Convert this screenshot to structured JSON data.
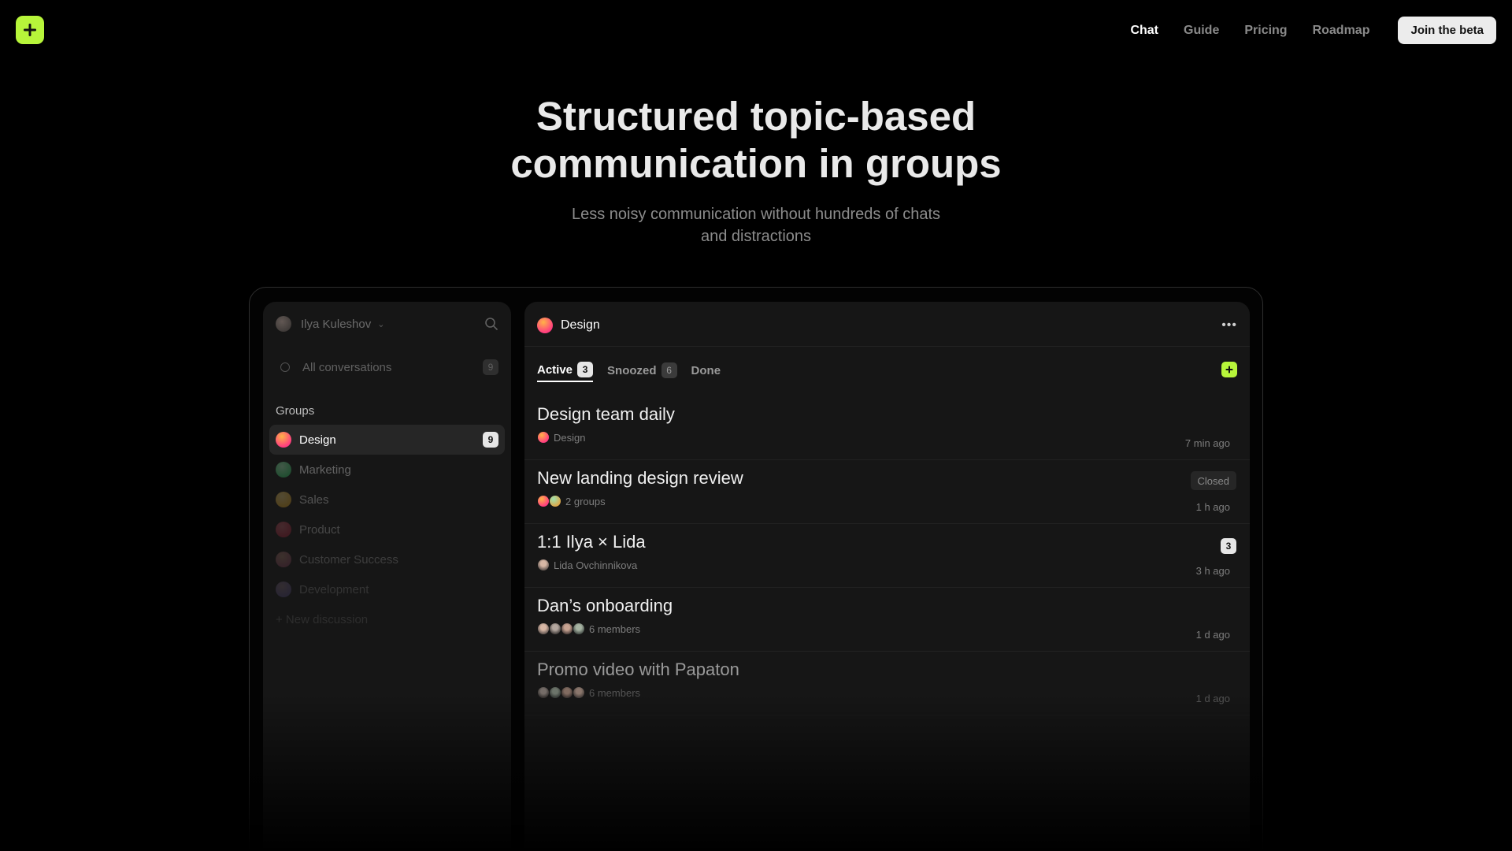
{
  "nav": {
    "links": [
      "Chat",
      "Guide",
      "Pricing",
      "Roadmap"
    ],
    "active": "Chat",
    "cta": "Join the beta"
  },
  "hero": {
    "title": "Structured topic-based\ncommunication in groups",
    "subtitle": "Less noisy communication without hundreds of chats\nand distractions"
  },
  "sidebar": {
    "user_name": "Ilya Kuleshov",
    "all_conversations": {
      "label": "All conversations",
      "count": "9"
    },
    "groups_label": "Groups",
    "groups": [
      {
        "label": "Design",
        "count": "9",
        "color": "#ff3d7f"
      },
      {
        "label": "Marketing",
        "color": "#3ec46d"
      },
      {
        "label": "Sales",
        "color": "#f5b82e"
      },
      {
        "label": "Product",
        "color": "#e5304f"
      },
      {
        "label": "Customer Success",
        "color": "#d96a8e"
      },
      {
        "label": "Development",
        "color": "#a98fff"
      }
    ],
    "new_discussion": "+ New discussion"
  },
  "main": {
    "title": "Design",
    "tabs": [
      {
        "label": "Active",
        "count": "3"
      },
      {
        "label": "Snoozed",
        "count": "6"
      },
      {
        "label": "Done"
      }
    ],
    "conversations": [
      {
        "title": "Design team daily",
        "sub": "Design",
        "time": "7 min ago"
      },
      {
        "title": "New landing design review",
        "sub": "2 groups",
        "time": "1 h ago",
        "tag": "Closed"
      },
      {
        "title": "1:1 Ilya × Lida",
        "sub": "Lida Ovchinnikova",
        "time": "3 h ago",
        "count": "3"
      },
      {
        "title": "Dan’s onboarding",
        "sub": "6 members",
        "time": "1 d ago"
      },
      {
        "title": "Promo video with Papaton",
        "sub": "6 members",
        "time": "1 d ago"
      }
    ]
  },
  "colors": {
    "accent": "#b7f53a",
    "background": "#000000",
    "panel": "#161616"
  }
}
